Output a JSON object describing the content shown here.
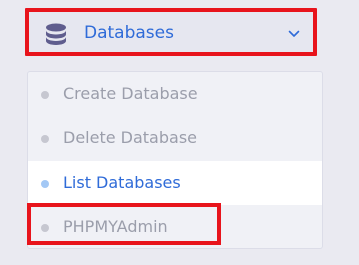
{
  "menu": {
    "title": "Databases",
    "icon": "database-icon",
    "chevron": "chevron-down-icon",
    "items": [
      {
        "label": "Create Database",
        "active": false
      },
      {
        "label": "Delete Database",
        "active": false
      },
      {
        "label": "List Databases",
        "active": true
      },
      {
        "label": "PHPMYAdmin",
        "active": false
      }
    ]
  },
  "colors": {
    "accent": "#2f6bd8",
    "highlight": "#e8141c",
    "muted_text": "#9b9eab",
    "active_bullet": "#a3c8f5"
  }
}
